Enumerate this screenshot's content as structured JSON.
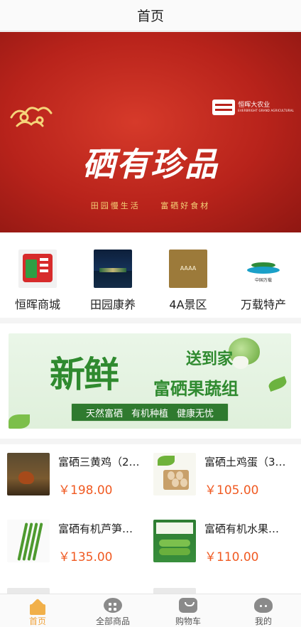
{
  "header": {
    "title": "首页"
  },
  "banner": {
    "brand_name": "恒晖大农业",
    "brand_en": "EVERBRIGHT GRAND AGRICULTURAL",
    "headline": "硒有珍品",
    "subline_left": "田园慢生活",
    "subline_right": "富硒好食材",
    "slides_total": 2,
    "active_slide": 2
  },
  "categories": [
    {
      "label": "恒晖商城",
      "icon": "mall-logo-icon"
    },
    {
      "label": "田园康养",
      "icon": "night-scene-icon"
    },
    {
      "label": "4A景区",
      "icon": "aaaa-badge-icon",
      "badge_text": "AAAA"
    },
    {
      "label": "万载特产",
      "icon": "wanzai-logo-icon",
      "badge_text": "中国万载"
    }
  ],
  "promo": {
    "big_text": "新鲜",
    "line1": "送到家",
    "line2": "富硒果蔬组",
    "tags": [
      "天然富硒",
      "有机种植",
      "健康无忧"
    ]
  },
  "products": [
    {
      "name": "富硒三黄鸡（2…",
      "price": "￥198.00",
      "image": "chicken-photo"
    },
    {
      "name": "富硒土鸡蛋（3…",
      "price": "￥105.00",
      "image": "eggs-photo"
    },
    {
      "name": "富硒有机芦笋…",
      "price": "￥135.00",
      "image": "asparagus-photo"
    },
    {
      "name": "富硒有机水果…",
      "price": "￥110.00",
      "image": "cucumber-photo"
    }
  ],
  "tabbar": {
    "items": [
      {
        "label": "首页",
        "icon": "home-icon",
        "active": true
      },
      {
        "label": "全部商品",
        "icon": "grid-icon",
        "active": false
      },
      {
        "label": "购物车",
        "icon": "cart-icon",
        "active": false
      },
      {
        "label": "我的",
        "icon": "profile-icon",
        "active": false
      }
    ],
    "active_color": "#f0a23a"
  },
  "colors": {
    "price": "#f05a22",
    "banner_red": "#b8231b",
    "promo_green": "#2f8a2f"
  }
}
